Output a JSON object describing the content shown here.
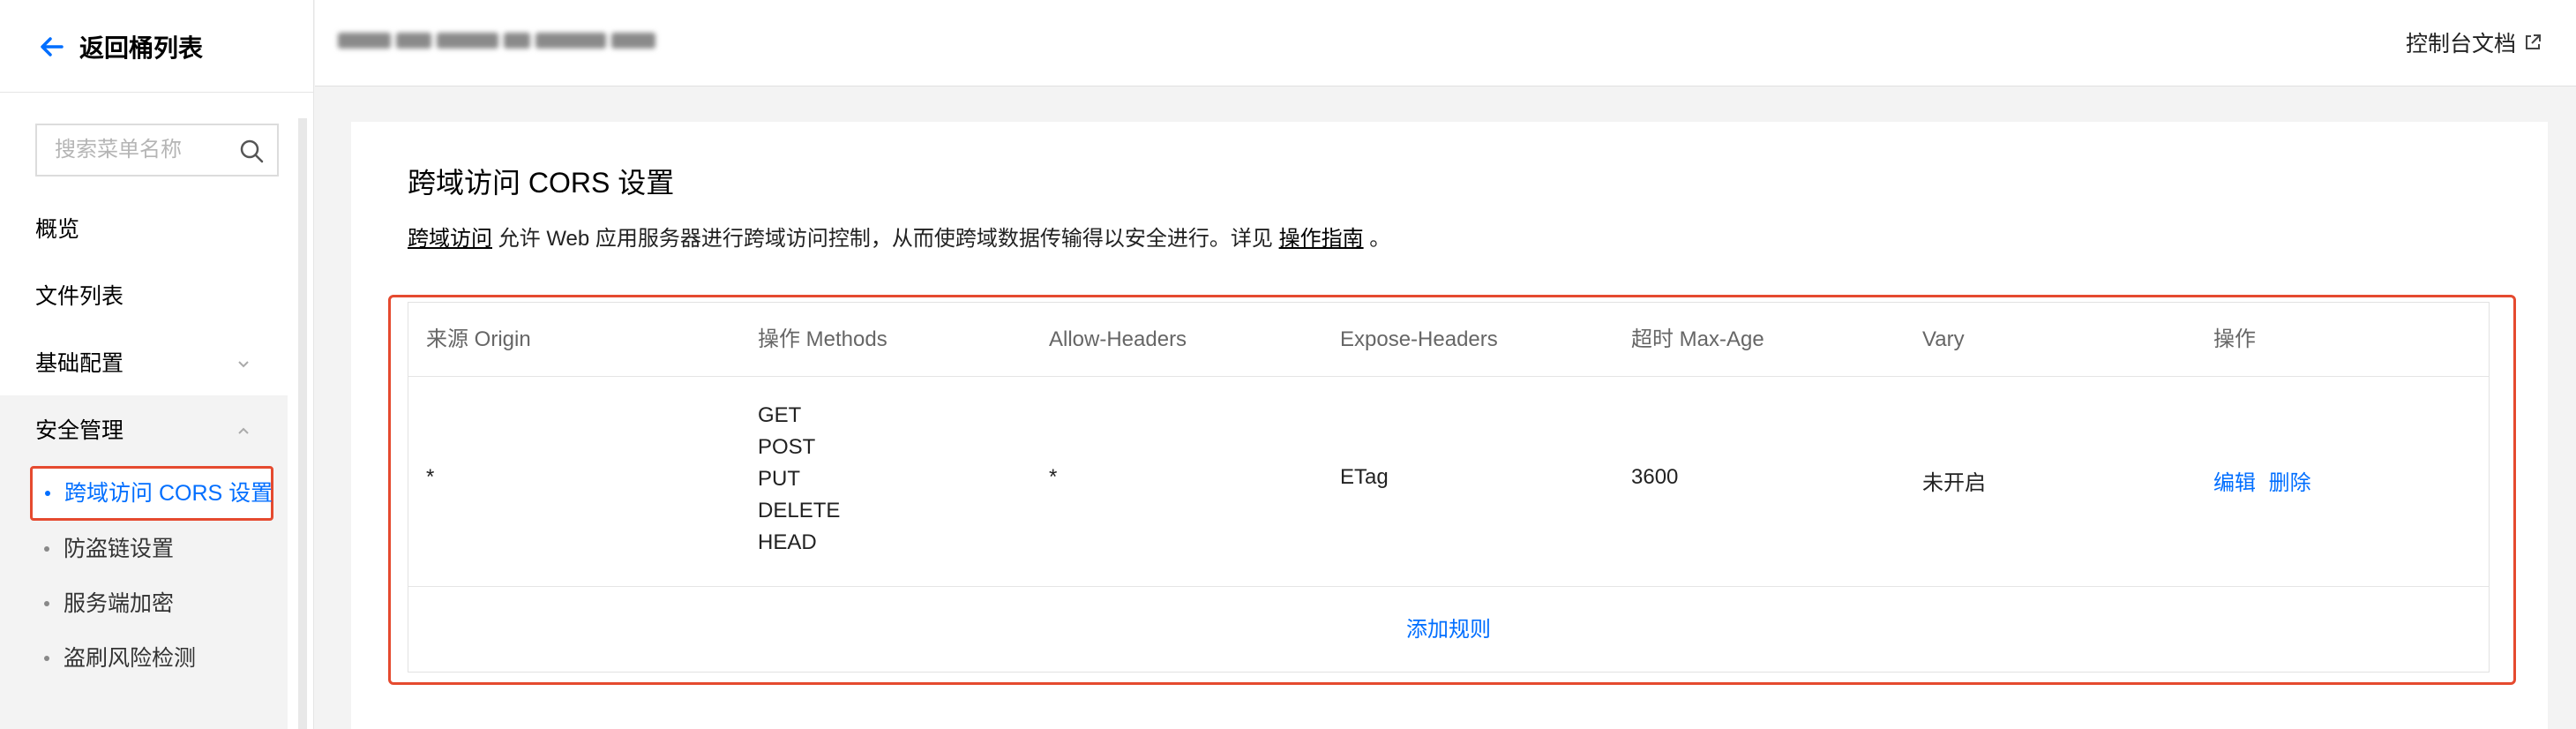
{
  "sidebar": {
    "back_label": "返回桶列表",
    "search_placeholder": "搜索菜单名称",
    "items": [
      {
        "label": "概览"
      },
      {
        "label": "文件列表"
      },
      {
        "label": "基础配置"
      },
      {
        "label": "安全管理"
      }
    ],
    "security_sub": [
      {
        "label": "跨域访问 CORS 设置",
        "active": true
      },
      {
        "label": "防盗链设置"
      },
      {
        "label": "服务端加密"
      },
      {
        "label": "盗刷风险检测"
      }
    ]
  },
  "header": {
    "doc_link": "控制台文档"
  },
  "main": {
    "title": "跨域访问 CORS 设置",
    "desc_link1": "跨域访问",
    "desc_text": " 允许 Web 应用服务器进行跨域访问控制，从而使跨域数据传输得以安全进行。详见 ",
    "desc_link2": "操作指南",
    "desc_end": " 。",
    "table": {
      "headers": [
        "来源 Origin",
        "操作 Methods",
        "Allow-Headers",
        "Expose-Headers",
        "超时 Max-Age",
        "Vary",
        "操作"
      ],
      "rows": [
        {
          "origin": "*",
          "methods": [
            "GET",
            "POST",
            "PUT",
            "DELETE",
            "HEAD"
          ],
          "allow_headers": "*",
          "expose_headers": "ETag",
          "max_age": "3600",
          "vary": "未开启",
          "edit": "编辑",
          "delete": "删除"
        }
      ],
      "add_rule": "添加规则"
    }
  },
  "colors": {
    "accent": "#006eff",
    "highlight": "#e54a2f"
  }
}
